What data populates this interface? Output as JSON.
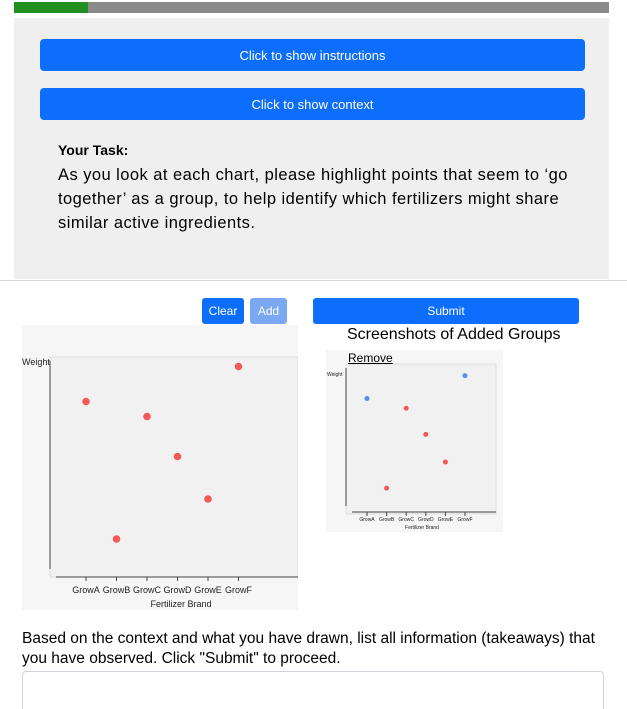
{
  "progress": {
    "value": 0.125
  },
  "buttons": {
    "instructions": "Click to show instructions",
    "context": "Click to show context",
    "clear": "Clear",
    "add": "Add",
    "submit": "Submit"
  },
  "task": {
    "title": "Your Task:",
    "body": "As you look at each chart, please highlight points that seem to ‘go together’ as a group, to help identify which fertilizers might share similar active ingredients."
  },
  "screenshots": {
    "title": "Screenshots of Added Groups",
    "remove": "Remove"
  },
  "question": "Based on the context and what you have drawn, list all information (takeaways) that you have observed. Click \"Submit\" to proceed.",
  "answer": {
    "value": ""
  },
  "colors": {
    "primary": "#0d6efd",
    "primary_disabled": "#7aa8f2",
    "point": "#f25a5a",
    "selected_point": "#5b8ee6",
    "highlight": "#f5f20f",
    "progress": "#1f8f1f"
  },
  "chart_data": [
    {
      "type": "scatter",
      "xlabel": "Fertilizer Brand",
      "ylabel": "Weight",
      "categories": [
        "GrowA",
        "GrowB",
        "GrowC",
        "GrowD",
        "GrowE",
        "GrowF"
      ],
      "values": [
        0.77,
        0.22,
        0.71,
        0.55,
        0.38,
        0.91
      ],
      "ylim": [
        0,
        1
      ]
    },
    {
      "type": "scatter",
      "xlabel": "Fertilizer Brand",
      "ylabel": "Weight",
      "categories": [
        "GrowA",
        "GrowB",
        "GrowC",
        "GrowD",
        "GrowE",
        "GrowF"
      ],
      "values": [
        0.77,
        0.22,
        0.71,
        0.55,
        0.38,
        0.91
      ],
      "selected": [
        0,
        5
      ],
      "ylim": [
        0,
        1
      ]
    }
  ]
}
